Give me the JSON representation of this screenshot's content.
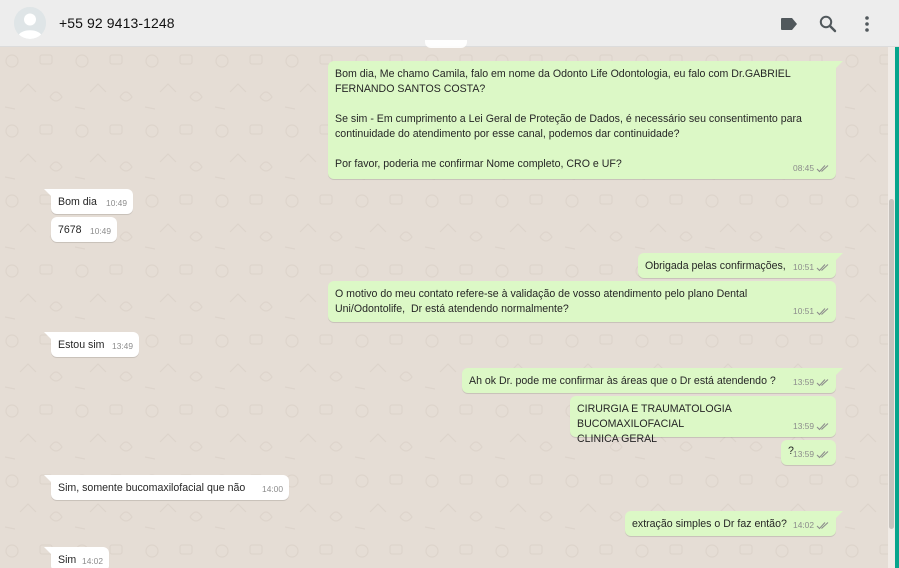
{
  "header": {
    "contact_name": "+55 92 9413-1248",
    "icons": [
      "label-icon",
      "search-icon",
      "menu-dots-icon"
    ]
  },
  "messages": [
    {
      "dir": "out",
      "text": "Bom dia, Me chamo Camila, falo em nome da Odonto Life Odontologia, eu falo com Dr.GABRIEL FERNANDO SANTOS COSTA?\n\nSe sim - Em cumprimento a Lei Geral de Proteção de Dados, é necessário seu consentimento para continuidade do atendimento por esse canal, podemos dar continuidade?\n\nPor favor, poderia me confirmar Nome completo, CRO e UF?",
      "time": "08:45"
    },
    {
      "dir": "in",
      "text": "Bom dia",
      "time": "10:49"
    },
    {
      "dir": "in",
      "text": "7678",
      "time": "10:49"
    },
    {
      "dir": "out",
      "text": "Obrigada pelas confirmações,",
      "time": "10:51"
    },
    {
      "dir": "out",
      "text": "O motivo do meu contato refere-se à validação de vosso atendimento pelo plano Dental Uni/Odontolife,  Dr está atendendo normalmente?",
      "time": "10:51"
    },
    {
      "dir": "in",
      "text": "Estou sim",
      "time": "13:49"
    },
    {
      "dir": "out",
      "text": "Ah ok Dr. pode me confirmar às áreas que o Dr está atendendo ?",
      "time": "13:59"
    },
    {
      "dir": "out",
      "text": "CIRURGIA E TRAUMATOLOGIA BUCOMAXILOFACIAL\nCLINICA GERAL",
      "time": "13:59"
    },
    {
      "dir": "out",
      "text": "?",
      "time": "13:59"
    },
    {
      "dir": "in",
      "text": "Sim, somente bucomaxilofacial que não",
      "time": "14:00"
    },
    {
      "dir": "out",
      "text": "extração simples o Dr faz então?",
      "time": "14:02"
    },
    {
      "dir": "in",
      "text": "Sim",
      "time": "14:02"
    }
  ],
  "colors": {
    "outgoing_bubble": "#dcf8c6",
    "incoming_bubble": "#ffffff",
    "chat_background": "#e5ddd5",
    "read_ticks": "#4fc3f7",
    "accent": "#06a58c"
  }
}
